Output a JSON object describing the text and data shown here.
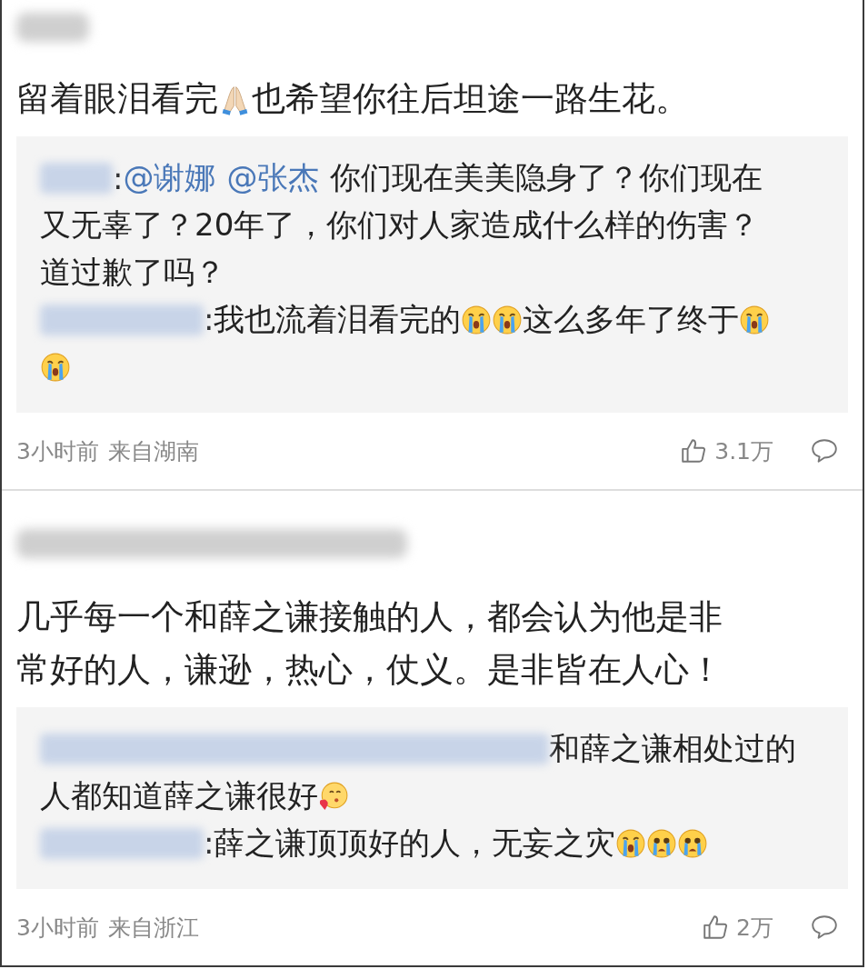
{
  "comments": [
    {
      "lines": [
        [
          {
            "kind": "text",
            "text": "留着眼泪看完"
          },
          {
            "kind": "pray-emoji"
          },
          {
            "kind": "text",
            "text": "也希望你往后坦途一路生花。"
          }
        ]
      ],
      "replies": [
        {
          "lines": [
            [
              {
                "kind": "text",
                "text": ":"
              },
              {
                "kind": "mention",
                "text": "@谢娜"
              },
              {
                "kind": "mention",
                "text": "@张杰"
              },
              {
                "kind": "text",
                "text": "你们现在美美隐身了？你们现在"
              }
            ],
            [
              {
                "kind": "text",
                "text": "又无辜了？20年了，你们对人家造成什么样的伤害？"
              }
            ],
            [
              {
                "kind": "text",
                "text": "道过歉了吗？"
              }
            ]
          ]
        },
        {
          "lines": [
            [
              {
                "kind": "text",
                "text": ":我也流着泪看完的"
              },
              {
                "kind": "cry-emoji"
              },
              {
                "kind": "cry-emoji"
              },
              {
                "kind": "text",
                "text": "这么多年了终于"
              },
              {
                "kind": "cry-emoji"
              }
            ],
            [
              {
                "kind": "cry-emoji"
              }
            ]
          ]
        }
      ],
      "time": "3小时前",
      "location": "来自湖南",
      "likes": "3.1万"
    },
    {
      "lines": [
        [
          {
            "kind": "text",
            "text": "几乎每一个和薛之谦接触的人，都会认为他是非"
          }
        ],
        [
          {
            "kind": "text",
            "text": "常好的人，谦逊，热心，仗义。是非皆在人心！"
          }
        ]
      ],
      "replies": [
        {
          "lines": [
            [
              {
                "kind": "text",
                "text": "和薛之谦相处过的"
              }
            ],
            [
              {
                "kind": "text",
                "text": "人都知道薛之谦很好"
              },
              {
                "kind": "heart-emoji"
              }
            ]
          ]
        },
        {
          "lines": [
            [
              {
                "kind": "text",
                "text": ":薛之谦顶顶好的人，无妄之灾"
              },
              {
                "kind": "cry-emoji"
              },
              {
                "kind": "tears-emoji"
              },
              {
                "kind": "tears-emoji"
              }
            ]
          ]
        }
      ],
      "time": "3小时前",
      "location": "来自浙江",
      "likes": "2万"
    }
  ]
}
